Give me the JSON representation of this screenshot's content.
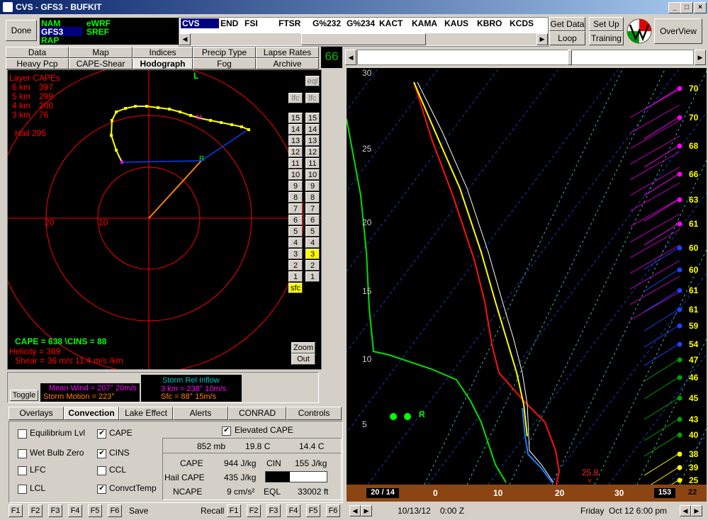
{
  "window": {
    "title": "CVS - GFS3 - BUFKIT",
    "min": "_",
    "max": "□",
    "close": "×"
  },
  "top": {
    "done": "Done",
    "models_left": [
      "NAM",
      "GFS3",
      "RAP"
    ],
    "models_right": [
      "eWRF",
      "SREF"
    ],
    "stations": [
      "CVS",
      "END",
      "FSI",
      "FTSR",
      "G%232",
      "G%234",
      "KACT",
      "KAMA",
      "KAUS",
      "KBRO",
      "KCDS"
    ],
    "get_data": "Get Data",
    "loop": "Loop",
    "set_up": "Set Up",
    "training": "Training",
    "overview": "OverView"
  },
  "tabs_row1": [
    "Data",
    "Map",
    "Indices",
    "Precip Type",
    "Lapse Rates"
  ],
  "tabs_row2": [
    "Heavy Pcp",
    "CAPE-Shear",
    "Hodograph",
    "Fog",
    "Archive"
  ],
  "frame_num": "66",
  "hodo": {
    "layer_title": "Layer CAPEs",
    "layers": [
      {
        "lbl": "6 km",
        "val": "397"
      },
      {
        "lbl": "5 km",
        "val": "299"
      },
      {
        "lbl": "4 km",
        "val": "200"
      },
      {
        "lbl": "3 km",
        "val": "76"
      }
    ],
    "hail": "Hail  295",
    "north": "L",
    "ring20": "20",
    "ring10": "10",
    "marker_m": "M",
    "marker_r": "R",
    "eql": "eql",
    "lfc": "lfc",
    "levels": [
      "15",
      "14",
      "13",
      "12",
      "11",
      "10",
      "9",
      "8",
      "7",
      "6",
      "5",
      "4",
      "3",
      "2",
      "1"
    ],
    "sfc": "sfc",
    "cape_line": "CAPE =  638 \\CINS =  88",
    "helicity": "Helicity =  369",
    "shear": "Shear =  36 m/s    11.4 m/s /km",
    "zoom": "Zoom",
    "out": "Out"
  },
  "wind": {
    "toggle": "Toggle",
    "mean_wind": "Mean Wind = 207°  20m/s",
    "storm_motion": "Storm Motion = 223°",
    "sri_title": "Storm Rel Inflow",
    "sri_3km": "3 km = 238°  10m/s",
    "sri_sfc": "Sfc = 88°  15m/s"
  },
  "lower_tabs": [
    "Overlays",
    "Convection",
    "Lake Effect",
    "Alerts",
    "CONRAD",
    "Controls"
  ],
  "checks": {
    "left": [
      {
        "label": "Equilibrium Lvl",
        "on": false
      },
      {
        "label": "Wet Bulb Zero",
        "on": false
      },
      {
        "label": "LFC",
        "on": false
      },
      {
        "label": "LCL",
        "on": false
      }
    ],
    "mid": [
      {
        "label": "CAPE",
        "on": true
      },
      {
        "label": "CINS",
        "on": true
      },
      {
        "label": "CCL",
        "on": false
      },
      {
        "label": "ConvctTemp",
        "on": true
      }
    ],
    "elevated": "Elevated CAPE"
  },
  "parcel": {
    "mb": "852 mb",
    "t": "19.8 C",
    "td": "14.4 C",
    "cape_lbl": "CAPE",
    "cape": "944 J/kg",
    "cin_lbl": "CIN",
    "cin": "155 J/kg",
    "hail_lbl": "Hail CAPE",
    "hail": "435 J/kg",
    "hail_fill": 0.4,
    "ncape_lbl": "NCAPE",
    "ncape": "9 cm/s²",
    "eql_lbl": "EQL",
    "eql": "33002 ft"
  },
  "fkeys": [
    "F1",
    "F2",
    "F3",
    "F4",
    "F5",
    "F6"
  ],
  "save": "Save",
  "recall": "Recall",
  "skewt": {
    "y_ticks": [
      "30",
      "25",
      "20",
      "15",
      "10",
      "5"
    ],
    "x_ticks": [
      "0",
      "10",
      "20",
      "30"
    ],
    "corner_left": "20 / 14",
    "corner_right": "153",
    "corner_far": "22",
    "marker": "25.8",
    "r_label": "R",
    "wind_speeds": [
      "70",
      "70",
      "68",
      "66",
      "63",
      "61",
      "60",
      "60",
      "61",
      "61",
      "59",
      "54",
      "47",
      "46",
      "45",
      "43",
      "40",
      "38",
      "39",
      "25"
    ]
  },
  "status": {
    "date": "10/13/12",
    "z": "0:00 Z",
    "day": "Friday",
    "when": "Oct 12  6:00 pm"
  }
}
